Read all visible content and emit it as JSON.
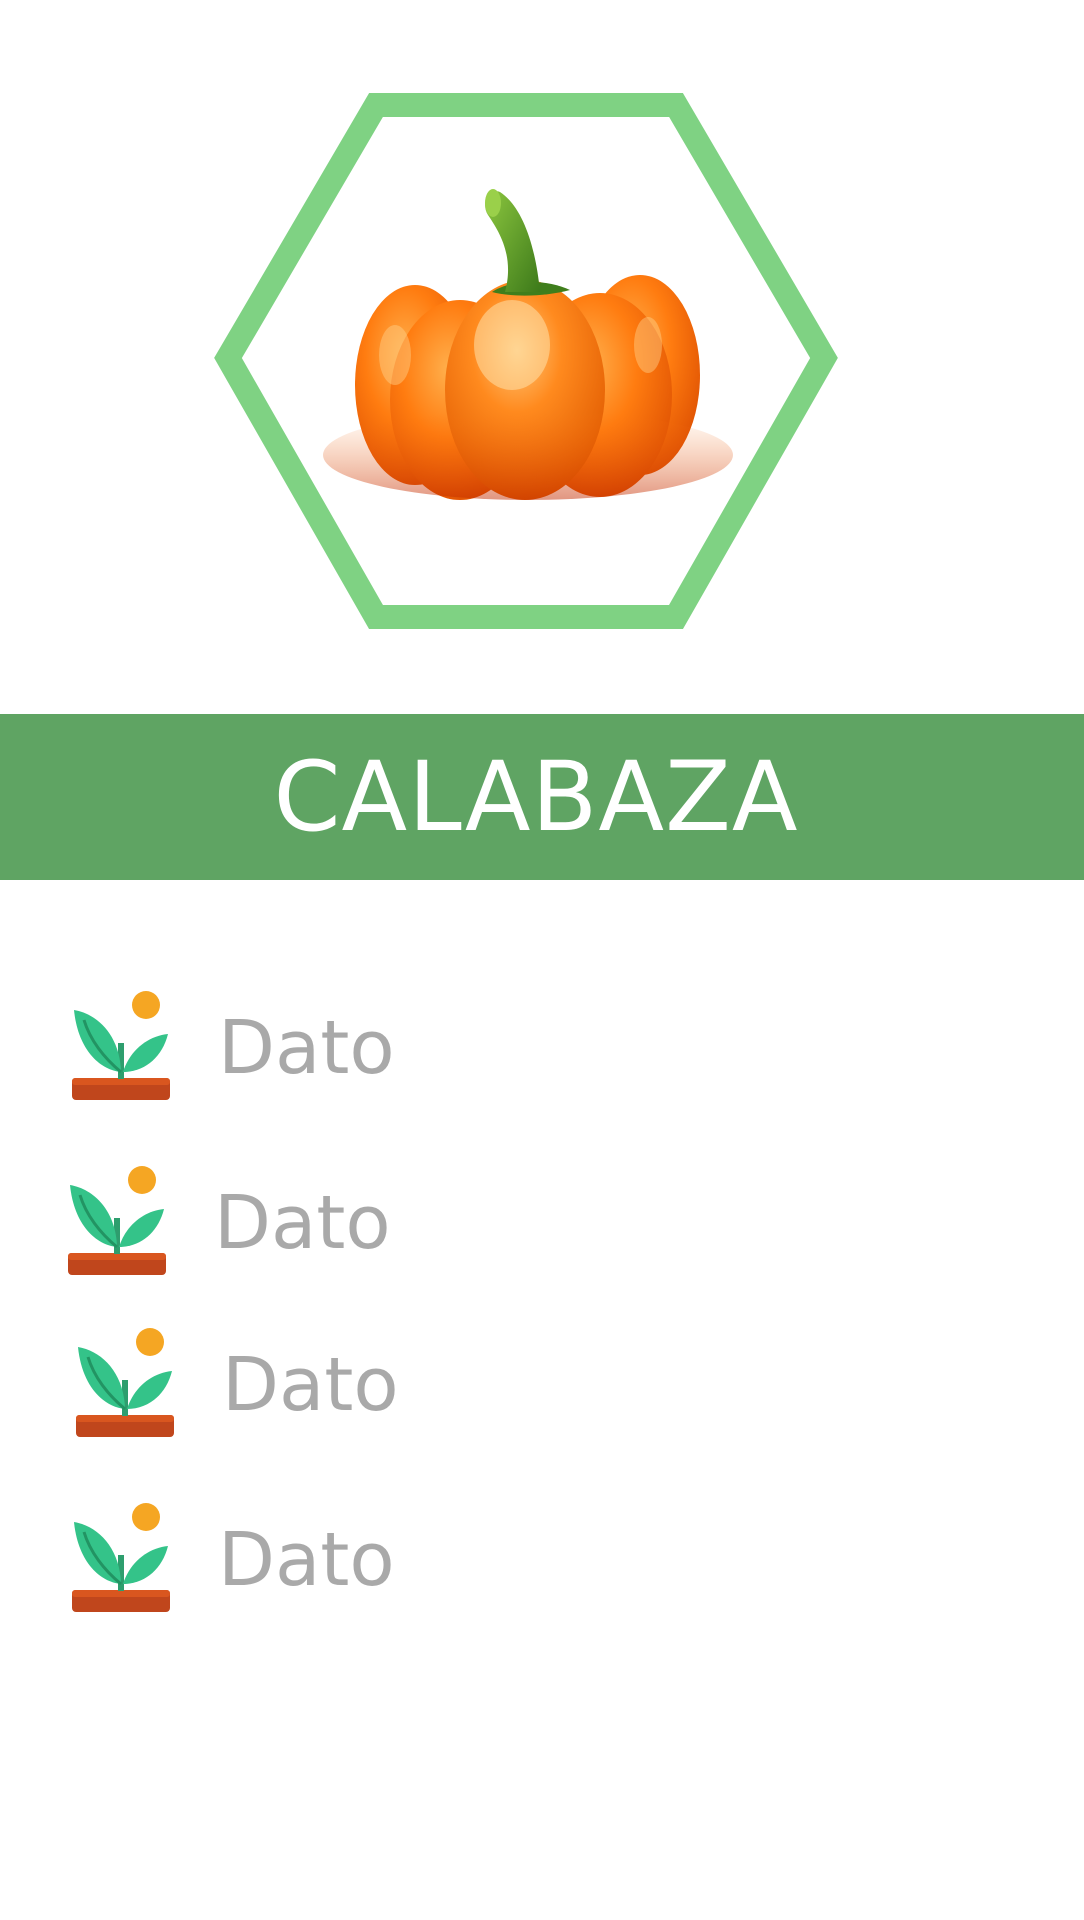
{
  "product": {
    "image": "pumpkin-image",
    "frame_color": "#7fd283",
    "name": "CALABAZA",
    "banner_color": "#5fa463"
  },
  "details": {
    "icon": "sprout-icon",
    "items": [
      {
        "label": "Dato"
      },
      {
        "label": "Dato"
      },
      {
        "label": "Dato"
      },
      {
        "label": "Dato"
      }
    ]
  }
}
